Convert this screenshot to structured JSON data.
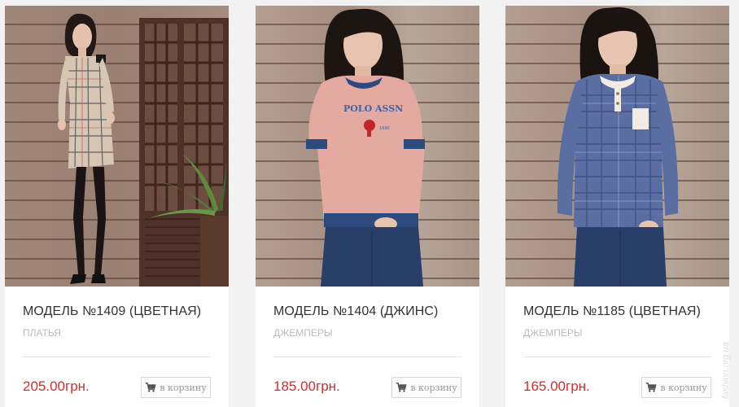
{
  "products": [
    {
      "title": "МОДЕЛЬ №1409 (ЦВЕТНАЯ)",
      "category": "ПЛАТЬЯ",
      "price": "205.00грн.",
      "cart_label": "в корзину",
      "image_icon": "product-photo-dress"
    },
    {
      "title": "МОДЕЛЬ №1404 (ДЖИНС)",
      "category": "ДЖЕМПЕРЫ",
      "price": "185.00грн.",
      "cart_label": "в корзину",
      "image_icon": "product-photo-jumper",
      "print_text": "POLO ASSN",
      "print_year": "1890"
    },
    {
      "title": "МОДЕЛЬ №1185 (ЦВЕТНАЯ)",
      "category": "ДЖЕМПЕРЫ",
      "price": "165.00грн.",
      "cart_label": "в корзину",
      "image_icon": "product-photo-checked-jumper"
    }
  ],
  "watermark": "fashion.org.ua",
  "colors": {
    "price": "#d62b2b",
    "title": "#333333",
    "category": "#bbbbbb",
    "background": "#f2f2f2"
  }
}
